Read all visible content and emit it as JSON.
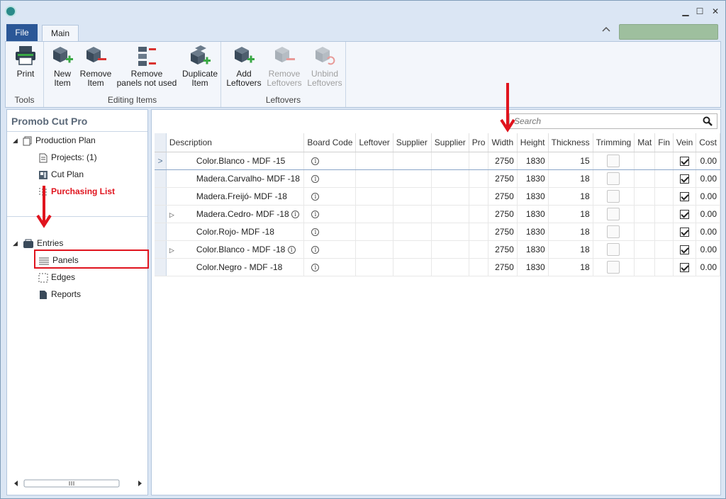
{
  "window": {
    "buttons": {
      "minimize": "▁",
      "maximize": "☐",
      "close": "✕"
    }
  },
  "menu": {
    "file_label": "File",
    "main_tab_label": "Main"
  },
  "ribbon": {
    "groups": [
      {
        "title": "Tools",
        "buttons": [
          {
            "label": "Print",
            "icon": "printer-icon",
            "enabled": true
          }
        ]
      },
      {
        "title": "Editing Items",
        "buttons": [
          {
            "label": "New\nItem",
            "icon": "new-item-icon",
            "enabled": true
          },
          {
            "label": "Remove\nItem",
            "icon": "remove-item-icon",
            "enabled": true
          },
          {
            "label": "Remove\npanels not used",
            "icon": "remove-panels-icon",
            "enabled": true
          },
          {
            "label": "Duplicate\nItem",
            "icon": "duplicate-item-icon",
            "enabled": true
          }
        ]
      },
      {
        "title": "Leftovers",
        "buttons": [
          {
            "label": "Add\nLeftovers",
            "icon": "add-leftovers-icon",
            "enabled": true
          },
          {
            "label": "Remove\nLeftovers",
            "icon": "remove-leftovers-icon",
            "enabled": false
          },
          {
            "label": "Unbind\nLeftovers",
            "icon": "unbind-leftovers-icon",
            "enabled": false
          }
        ]
      }
    ]
  },
  "sidebar": {
    "title": "Promob Cut Pro",
    "tree": {
      "production_plan": "Production Plan",
      "projects": "Projects: (1)",
      "cut_plan": "Cut Plan",
      "purchasing_list": "Purchasing List",
      "entries": "Entries",
      "panels": "Panels",
      "edges": "Edges",
      "reports": "Reports"
    }
  },
  "search": {
    "placeholder": "Search"
  },
  "grid": {
    "columns": [
      "Description",
      "Board Code",
      "Leftover",
      "Supplier",
      "Supplier",
      "Pro",
      "Width",
      "Height",
      "Thickness",
      "Trimming",
      "Mat",
      "Fin",
      "Vein",
      "Cost"
    ],
    "rows": [
      {
        "description": "Color.Blanco - MDF -15",
        "width": "2750",
        "height": "1830",
        "thickness": "15",
        "vein": true,
        "cost": "0.00",
        "expandable": false,
        "inline_info": false,
        "current": true
      },
      {
        "description": "Madera.Carvalho- MDF -18",
        "width": "2750",
        "height": "1830",
        "thickness": "18",
        "vein": true,
        "cost": "0.00",
        "expandable": false,
        "inline_info": false,
        "current": false
      },
      {
        "description": "Madera.Freijó- MDF -18",
        "width": "2750",
        "height": "1830",
        "thickness": "18",
        "vein": true,
        "cost": "0.00",
        "expandable": false,
        "inline_info": false,
        "current": false
      },
      {
        "description": "Madera.Cedro- MDF -18",
        "width": "2750",
        "height": "1830",
        "thickness": "18",
        "vein": true,
        "cost": "0.00",
        "expandable": true,
        "inline_info": true,
        "current": false
      },
      {
        "description": "Color.Rojo- MDF -18",
        "width": "2750",
        "height": "1830",
        "thickness": "18",
        "vein": true,
        "cost": "0.00",
        "expandable": false,
        "inline_info": false,
        "current": false
      },
      {
        "description": "Color.Blanco - MDF -18",
        "width": "2750",
        "height": "1830",
        "thickness": "18",
        "vein": true,
        "cost": "0.00",
        "expandable": true,
        "inline_info": true,
        "current": false
      },
      {
        "description": "Color.Negro - MDF -18",
        "width": "2750",
        "height": "1830",
        "thickness": "18",
        "vein": true,
        "cost": "0.00",
        "expandable": false,
        "inline_info": false,
        "current": false
      }
    ]
  },
  "colors": {
    "accent": "#2b5797",
    "highlight_red": "#e0141e",
    "status_block": "#9ebf9e"
  }
}
